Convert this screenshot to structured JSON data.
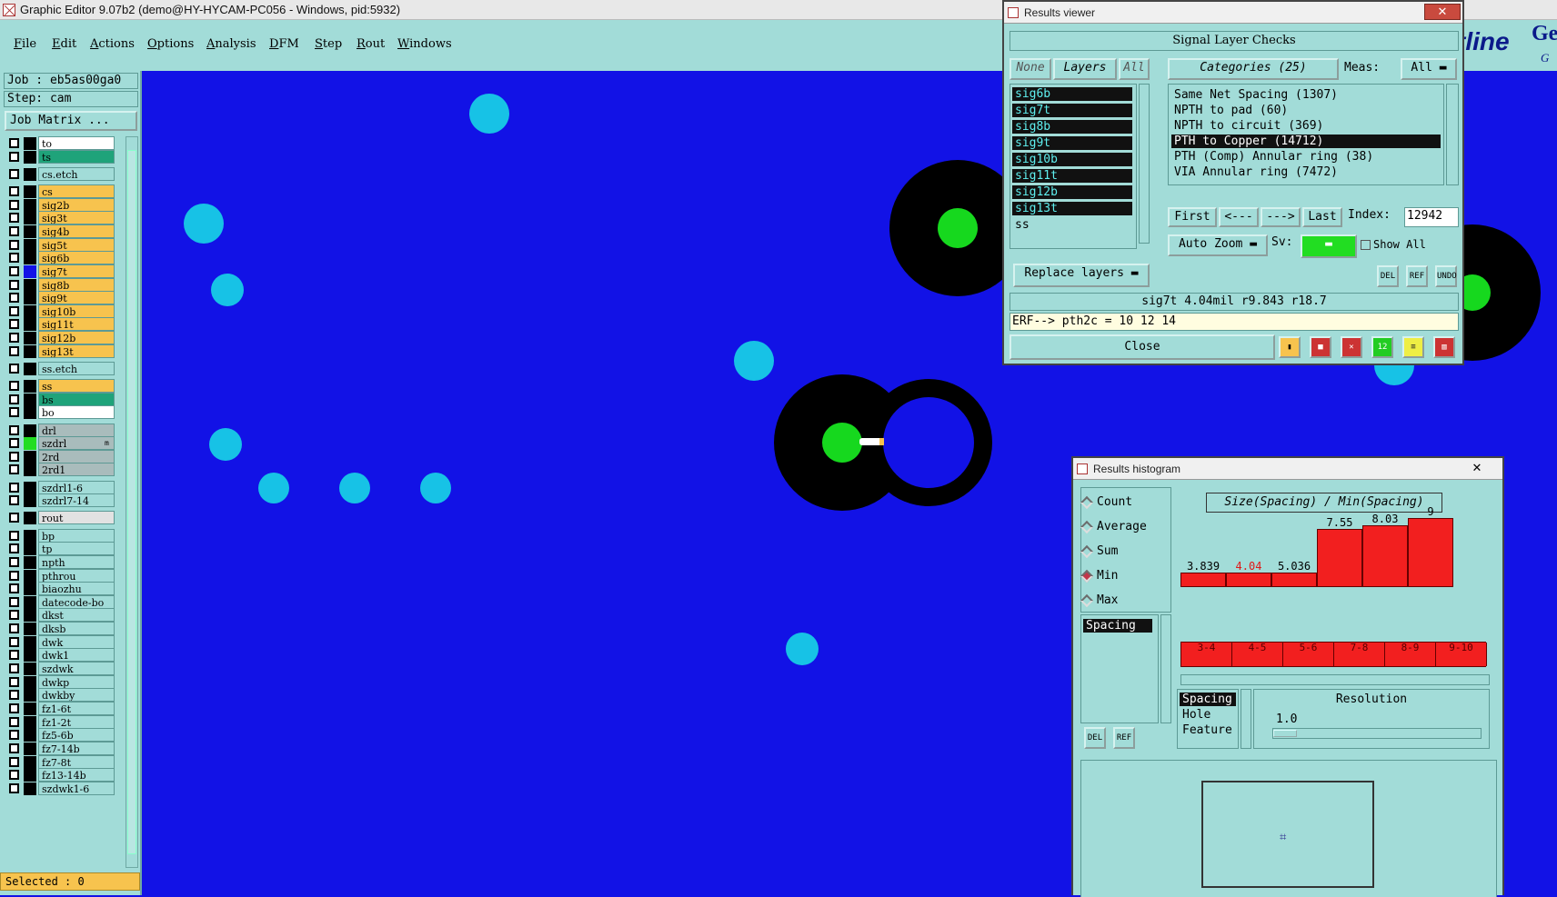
{
  "window_title": "Graphic Editor 9.07b2 (demo@HY-HYCAM-PC056 - Windows, pid:5932)",
  "menu": [
    "File",
    "Edit",
    "Actions",
    "Options",
    "Analysis",
    "DFM",
    "Step",
    "Rout",
    "Windows"
  ],
  "logo": {
    "part1": "tline",
    "part2": "Ger",
    "part3": "G"
  },
  "job": {
    "job_label": "Job : eb5as00ga0",
    "step_label": "Step: cam",
    "matrix_button": "Job Matrix ..."
  },
  "layers": [
    {
      "name": "to",
      "color": "#ffffff",
      "swatch": "#000000"
    },
    {
      "name": "ts",
      "color": "#1fa37a",
      "swatch": "#000000"
    },
    {
      "name": "cs.etch",
      "color": "#a2dcd8",
      "swatch": "#000000"
    },
    {
      "name": "cs",
      "color": "#f7c34e",
      "swatch": "#000000"
    },
    {
      "name": "sig2b",
      "color": "#f7c34e",
      "swatch": "#000000"
    },
    {
      "name": "sig3t",
      "color": "#f7c34e",
      "swatch": "#000000"
    },
    {
      "name": "sig4b",
      "color": "#f7c34e",
      "swatch": "#000000"
    },
    {
      "name": "sig5t",
      "color": "#f7c34e",
      "swatch": "#000000"
    },
    {
      "name": "sig6b",
      "color": "#f7c34e",
      "swatch": "#000000"
    },
    {
      "name": "sig7t",
      "color": "#f7c34e",
      "swatch": "#1212e6"
    },
    {
      "name": "sig8b",
      "color": "#f7c34e",
      "swatch": "#000000"
    },
    {
      "name": "sig9t",
      "color": "#f7c34e",
      "swatch": "#000000"
    },
    {
      "name": "sig10b",
      "color": "#f7c34e",
      "swatch": "#000000"
    },
    {
      "name": "sig11t",
      "color": "#f7c34e",
      "swatch": "#000000"
    },
    {
      "name": "sig12b",
      "color": "#f7c34e",
      "swatch": "#000000"
    },
    {
      "name": "sig13t",
      "color": "#f7c34e",
      "swatch": "#000000"
    },
    {
      "name": "ss.etch",
      "color": "#a2dcd8",
      "swatch": "#000000"
    },
    {
      "name": "ss",
      "color": "#f7c34e",
      "swatch": "#000000"
    },
    {
      "name": "bs",
      "color": "#1fa37a",
      "swatch": "#000000"
    },
    {
      "name": "bo",
      "color": "#ffffff",
      "swatch": "#000000"
    },
    {
      "name": "drl",
      "color": "#a9bcbc",
      "swatch": "#000000"
    },
    {
      "name": "szdrl",
      "color": "#a9bcbc",
      "swatch": "#22dd22",
      "mark": "m"
    },
    {
      "name": "2rd",
      "color": "#a9bcbc",
      "swatch": "#000000"
    },
    {
      "name": "2rd1",
      "color": "#a9bcbc",
      "swatch": "#000000"
    },
    {
      "name": "szdrl1-6",
      "color": "#a2dcd8",
      "swatch": "#000000"
    },
    {
      "name": "szdrl7-14",
      "color": "#a2dcd8",
      "swatch": "#000000"
    },
    {
      "name": "rout",
      "color": "#e2e2e2",
      "swatch": "#000000"
    },
    {
      "name": "bp",
      "color": "#a2dcd8",
      "swatch": "#000000"
    },
    {
      "name": "tp",
      "color": "#a2dcd8",
      "swatch": "#000000"
    },
    {
      "name": "npth",
      "color": "#a2dcd8",
      "swatch": "#000000"
    },
    {
      "name": "pthrou",
      "color": "#a2dcd8",
      "swatch": "#000000"
    },
    {
      "name": "biaozhu",
      "color": "#a2dcd8",
      "swatch": "#000000"
    },
    {
      "name": "datecode-bo",
      "color": "#a2dcd8",
      "swatch": "#000000"
    },
    {
      "name": "dkst",
      "color": "#a2dcd8",
      "swatch": "#000000"
    },
    {
      "name": "dksb",
      "color": "#a2dcd8",
      "swatch": "#000000"
    },
    {
      "name": "dwk",
      "color": "#a2dcd8",
      "swatch": "#000000"
    },
    {
      "name": "dwk1",
      "color": "#a2dcd8",
      "swatch": "#000000"
    },
    {
      "name": "szdwk",
      "color": "#a2dcd8",
      "swatch": "#000000"
    },
    {
      "name": "dwkp",
      "color": "#a2dcd8",
      "swatch": "#000000"
    },
    {
      "name": "dwkby",
      "color": "#a2dcd8",
      "swatch": "#000000"
    },
    {
      "name": "fz1-6t",
      "color": "#a2dcd8",
      "swatch": "#000000"
    },
    {
      "name": "fz1-2t",
      "color": "#a2dcd8",
      "swatch": "#000000"
    },
    {
      "name": "fz5-6b",
      "color": "#a2dcd8",
      "swatch": "#000000"
    },
    {
      "name": "fz7-14b",
      "color": "#a2dcd8",
      "swatch": "#000000"
    },
    {
      "name": "fz7-8t",
      "color": "#a2dcd8",
      "swatch": "#000000"
    },
    {
      "name": "fz13-14b",
      "color": "#a2dcd8",
      "swatch": "#000000"
    },
    {
      "name": "szdwk1-6",
      "color": "#a2dcd8",
      "swatch": "#000000"
    }
  ],
  "selected_label": "Selected : 0",
  "results_viewer": {
    "title": "Results viewer",
    "close_x": "✕",
    "header": "Signal Layer Checks",
    "none_btn": "None",
    "layers_btn": "Layers",
    "all_btn": "All",
    "layer_items": [
      "sig6b",
      "sig7t",
      "sig8b",
      "sig9t",
      "sig10b",
      "sig11t",
      "sig12b",
      "sig13t",
      "ss"
    ],
    "categories_btn": "Categories (25)",
    "meas_label": "Meas:",
    "meas_value": "All",
    "categories": [
      "Same Net Spacing (1307)",
      "NPTH to pad (60)",
      "NPTH to circuit (369)",
      "PTH to Copper (14712)",
      "PTH (Comp) Annular ring (38)",
      "VIA Annular ring (7472)"
    ],
    "first_btn": "First",
    "prev_btn": "<---",
    "next_btn": "--->",
    "last_btn": "Last",
    "index_label": "Index:",
    "index_value": "12942",
    "auto_zoom": "Auto Zoom",
    "sv_label": "Sv:",
    "show_all": "Show All",
    "replace_layers": "Replace layers",
    "tool_labels": [
      "DEL",
      "REF",
      "UNDO"
    ],
    "measurement": "sig7t 4.04mil  r9.843  r18.7",
    "erf": "ERF--> pth2c = 10 12 14",
    "close_btn": "Close",
    "sv_color": "#22dd22"
  },
  "histogram": {
    "title": "Results histogram",
    "radios": [
      {
        "label": "Count",
        "on": false
      },
      {
        "label": "Average",
        "on": false
      },
      {
        "label": "Sum",
        "on": false
      },
      {
        "label": "Min",
        "on": true
      },
      {
        "label": "Max",
        "on": false
      }
    ],
    "measure_items": [
      "Spacing"
    ],
    "chart_title": "Size(Spacing) / Min(Spacing)",
    "bins": [
      {
        "range": "3-4",
        "value": "3.839",
        "highlight": false,
        "v": 3.839
      },
      {
        "range": "4-5",
        "value": "4.04",
        "highlight": true,
        "v": 4.04
      },
      {
        "range": "5-6",
        "value": "5.036",
        "highlight": false,
        "v": 5.036
      },
      {
        "range": "7-8",
        "value": "7.55",
        "highlight": false,
        "v": 7.55
      },
      {
        "range": "8-9",
        "value": "8.03",
        "highlight": false,
        "v": 8.03
      },
      {
        "range": "9-10",
        "value": "9",
        "highlight": false,
        "v": 9
      }
    ],
    "type_items": [
      "Spacing",
      "Hole",
      "Feature"
    ],
    "resolution_label": "Resolution",
    "resolution_value": "1.0",
    "tool_labels": [
      "DEL",
      "REF"
    ],
    "preview_glyph": "⌗"
  }
}
